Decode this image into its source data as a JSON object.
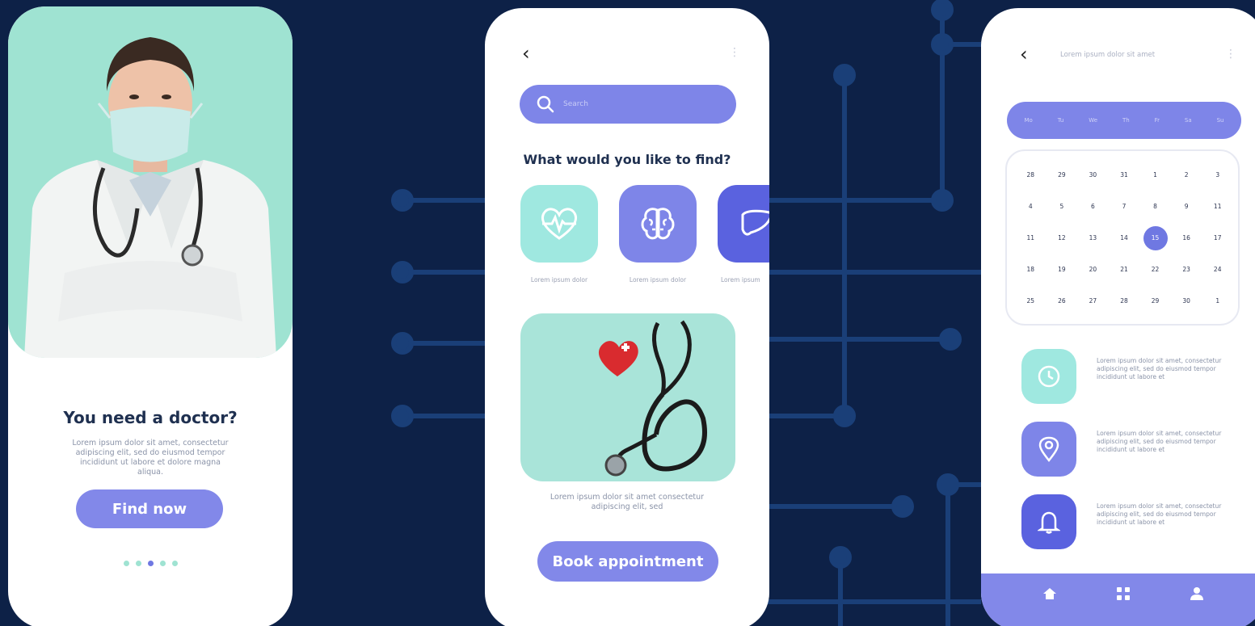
{
  "colors": {
    "background": "#0d2147",
    "accent": "#8288e9",
    "accent_dark": "#6f78e2",
    "mint": "#9fe3d2",
    "text_dark": "#1f3050",
    "text_muted": "#8a93a8"
  },
  "phone1": {
    "title": "You need a doctor?",
    "body": "Lorem ipsum dolor sit amet, consectetur adipiscing elit, sed do eiusmod tempor incididunt ut labore et dolore magna aliqua.",
    "button_label": "Find now",
    "pager": {
      "count": 5,
      "active_index": 2
    }
  },
  "phone2": {
    "back_glyph": "‹",
    "more_glyph": "⋮",
    "search_placeholder": "Search",
    "heading": "What would you like to find?",
    "categories": [
      {
        "label": "Lorem ipsum dolor",
        "icon": "heart-pulse-icon"
      },
      {
        "label": "Lorem ipsum dolor",
        "icon": "brain-icon"
      },
      {
        "label": "Lorem ipsum",
        "icon": "liver-icon"
      }
    ],
    "caption": "Lorem ipsum dolor sit amet consectetur adipiscing elit, sed",
    "button_label": "Book appointment"
  },
  "phone3": {
    "back_glyph": "‹",
    "more_glyph": "⋮",
    "title": "Lorem ipsum dolor sit amet",
    "weekdays": [
      "Mo",
      "Tu",
      "We",
      "Th",
      "Fr",
      "Sa",
      "Su"
    ],
    "days": [
      "28",
      "29",
      "30",
      "31",
      "1",
      "2",
      "3",
      "4",
      "5",
      "6",
      "7",
      "8",
      "9",
      "11",
      "11",
      "12",
      "13",
      "14",
      "15",
      "16",
      "17",
      "18",
      "19",
      "20",
      "21",
      "22",
      "23",
      "24",
      "25",
      "26",
      "27",
      "28",
      "29",
      "30",
      "1"
    ],
    "selected_day": "15",
    "info_items": [
      {
        "icon": "clock-icon",
        "text": "Lorem ipsum dolor sit amet, consectetur adipiscing elit, sed do eiusmod tempor incididunt ut labore et"
      },
      {
        "icon": "location-pin-icon",
        "text": "Lorem ipsum dolor sit amet, consectetur adipiscing elit, sed do eiusmod tempor incididunt ut labore et"
      },
      {
        "icon": "bell-icon",
        "text": "Lorem ipsum dolor sit amet, consectetur adipiscing elit, sed do eiusmod tempor incididunt ut labore et"
      }
    ],
    "tabs": [
      "home-icon",
      "grid-icon",
      "user-icon"
    ]
  }
}
